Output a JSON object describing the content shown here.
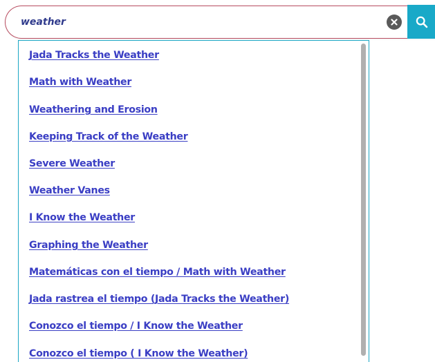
{
  "search": {
    "value": "weather",
    "placeholder": ""
  },
  "icons": {
    "clear": "clear-x-icon",
    "search": "magnifier-icon"
  },
  "colors": {
    "search_border": "#b84b5f",
    "search_button": "#19a9c8",
    "dropdown_border": "#1aa6c4",
    "link": "#3a3ec4",
    "input_text": "#2f3a8c"
  },
  "suggestions": [
    {
      "label": "Jada Tracks the Weather"
    },
    {
      "label": "Math with Weather"
    },
    {
      "label": "Weathering and Erosion"
    },
    {
      "label": "Keeping Track of the Weather"
    },
    {
      "label": "Severe Weather"
    },
    {
      "label": "Weather Vanes"
    },
    {
      "label": "I Know the Weather"
    },
    {
      "label": "Graphing the Weather"
    },
    {
      "label": "Matemáticas con el tiempo / Math with Weather"
    },
    {
      "label": "Jada rastrea el tiempo (Jada Tracks the Weather)"
    },
    {
      "label": "Conozco el tiempo / I Know the Weather"
    },
    {
      "label": "Conozco el tiempo ( I Know the Weather)"
    }
  ]
}
